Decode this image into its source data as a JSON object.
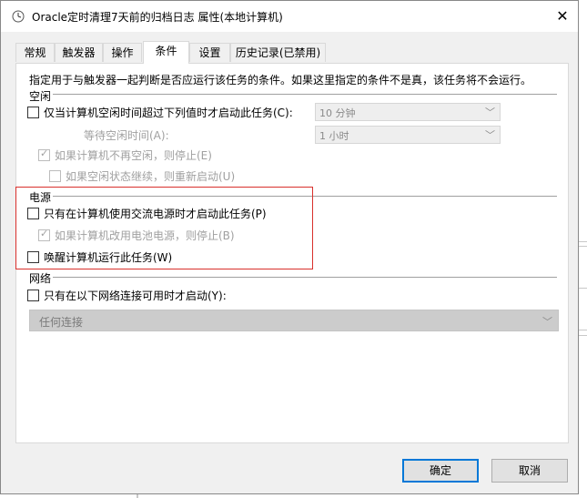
{
  "window": {
    "title": "Oracle定时清理7天前的归档日志 属性(本地计算机)",
    "close_glyph": "✕"
  },
  "tabs": [
    {
      "label": "常规"
    },
    {
      "label": "触发器"
    },
    {
      "label": "操作"
    },
    {
      "label": "条件",
      "active": true
    },
    {
      "label": "设置"
    },
    {
      "label": "历史记录(已禁用)"
    }
  ],
  "conditions": {
    "description": "指定用于与触发器一起判断是否应运行该任务的条件。如果这里指定的条件不是真，该任务将不会运行。",
    "idle": {
      "group_label": "空闲",
      "start_if_idle": {
        "label": "仅当计算机空闲时间超过下列值时才启动此任务(C):",
        "checked": false
      },
      "idle_duration": {
        "value": "10 分钟"
      },
      "wait_label": "等待空闲时间(A):",
      "wait_duration": {
        "value": "1 小时"
      },
      "stop_if_not_idle": {
        "label": "如果计算机不再空闲，则停止(E)",
        "checked": true,
        "disabled": true
      },
      "restart_if_idle": {
        "label": "如果空闲状态继续，则重新启动(U)",
        "checked": false,
        "disabled": true
      }
    },
    "power": {
      "group_label": "电源",
      "ac_only": {
        "label": "只有在计算机使用交流电源时才启动此任务(P)",
        "checked": false
      },
      "stop_on_battery": {
        "label": "如果计算机改用电池电源，则停止(B)",
        "checked": true,
        "disabled": true
      },
      "wake_to_run": {
        "label": "唤醒计算机运行此任务(W)",
        "checked": false
      }
    },
    "network": {
      "group_label": "网络",
      "network_only": {
        "label": "只有在以下网络连接可用时才启动(Y):",
        "checked": false
      },
      "connection": {
        "value": "任何连接"
      }
    }
  },
  "buttons": {
    "ok_label": "确定",
    "cancel_label": "取消"
  },
  "colors": {
    "highlight_box": "#d9302c",
    "ok_border": "#0078d7"
  },
  "icons": {
    "title": "clock-icon",
    "dropdown": "chevron-down-icon",
    "check": "✓"
  }
}
